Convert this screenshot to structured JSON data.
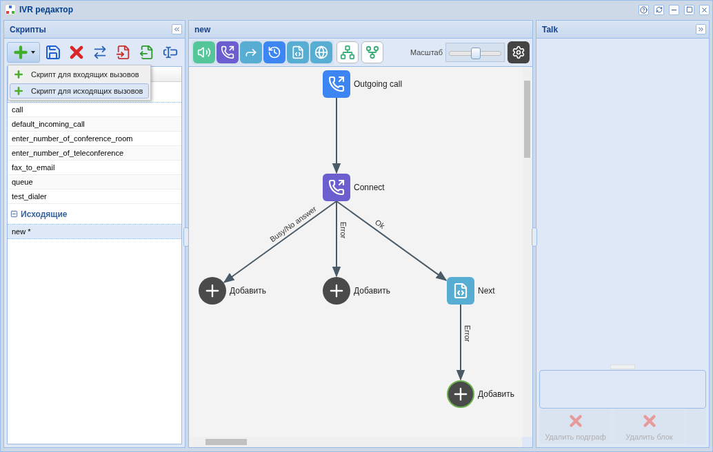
{
  "window": {
    "title": "IVR редактор"
  },
  "scripts_panel": {
    "title": "Скрипты",
    "add_menu": {
      "open": true,
      "items": [
        {
          "label": "Скрипт для входящих вызовов",
          "selected": false
        },
        {
          "label": "Скрипт для исходящих вызовов",
          "selected": true
        }
      ]
    },
    "groups": [
      {
        "rows": [
          {
            "label": "call",
            "selected": false
          },
          {
            "label": "default_incoming_call",
            "selected": false
          },
          {
            "label": "enter_number_of_conference_room",
            "selected": false
          },
          {
            "label": "enter_number_of_teleconference",
            "selected": false
          },
          {
            "label": "fax_to_email",
            "selected": false
          },
          {
            "label": "queue",
            "selected": false
          },
          {
            "label": "test_dialer",
            "selected": false
          }
        ]
      },
      {
        "name": "Исходящие",
        "expanded": true,
        "rows": [
          {
            "label": "new *",
            "selected": true
          }
        ]
      }
    ]
  },
  "editor": {
    "title": "new",
    "zoom": {
      "label": "Масштаб",
      "level": 0.5
    },
    "diagram": {
      "nodes": [
        {
          "kind": "outgoing",
          "label": "Outgoing call",
          "selected": false,
          "children": [
            {
              "kind": "connect",
              "label": "Connect",
              "selected": false,
              "children": [
                {
                  "kind": "add",
                  "label": "Добавить",
                  "selected": false,
                  "edge_label": "Busy/No answer"
                },
                {
                  "kind": "add",
                  "label": "Добавить",
                  "selected": false,
                  "edge_label": "Error"
                },
                {
                  "kind": "script",
                  "label": "Next",
                  "selected": false,
                  "edge_label": "Ok",
                  "children": [
                    {
                      "kind": "add",
                      "label": "Добавить",
                      "selected": true,
                      "edge_label": "Error"
                    }
                  ]
                }
              ]
            }
          ]
        }
      ]
    }
  },
  "talk_panel": {
    "title": "Talk",
    "buttons": [
      {
        "label": "Удалить подграф",
        "disabled": true
      },
      {
        "label": "Удалить блок",
        "disabled": true
      }
    ]
  }
}
